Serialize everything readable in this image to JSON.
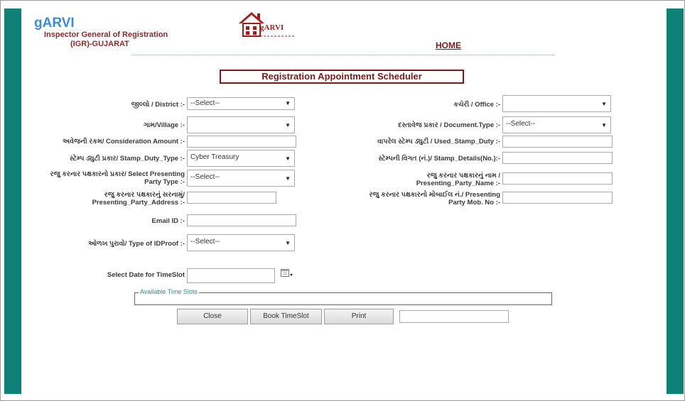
{
  "brand": {
    "name": "gARVI",
    "line1": "Inspector General of Registration",
    "line2": "(IGR)-GUJARAT",
    "logo_text": "gARVI"
  },
  "nav": {
    "home": "HOME"
  },
  "form": {
    "title": "Registration Appointment Scheduler",
    "district": {
      "label": "જીલ્લો / District :-",
      "value": "--Select--"
    },
    "office": {
      "label": "કચેરી / Office :-",
      "value": ""
    },
    "village": {
      "label": "ગામ/Village :-",
      "value": ""
    },
    "document_type": {
      "label": "દસ્તાવેજ પ્રકાર / Document.Type :-",
      "value": "--Select--"
    },
    "consideration_amount": {
      "label": "અવેજની રકમ/ Consideration Amount :-",
      "value": ""
    },
    "used_stamp_duty": {
      "label": "વાપરેલ સ્ટેમ્પ ડ્યુટી / Used_Stamp_Duty :-",
      "value": ""
    },
    "stamp_duty_type": {
      "label": "સ્ટેમ્પ ડ્યુટી પ્રકાર/ Stamp_Duty_Type :-",
      "value": "Cyber Treasury"
    },
    "stamp_details": {
      "label": "સ્ટેમ્પની વિગત (નં.)/ Stamp_Details(No.):-",
      "value": ""
    },
    "presenting_party_type": {
      "label_line1": "રજુ કરનાર પક્ષકારનો પ્રકાર/ Select Presenting",
      "label_line2": "Party Type :-",
      "value": "--Select--"
    },
    "presenting_party_name": {
      "label_line1": "રજુ કરનાર પક્ષકારનું નામ /",
      "label_line2": "Presenting_Party_Name :-",
      "value": ""
    },
    "presenting_party_address": {
      "label_line1": "રજુ કરનાર પક્ષકારનું સરનામું/",
      "label_line2": "Presenting_Party_Address :-",
      "value": ""
    },
    "presenting_party_mobile": {
      "label_line1": "રજુ કરનાર પક્ષકારનો મોબાઈલ નં./ Presenting",
      "label_line2": "Party Mob. No :-",
      "value": ""
    },
    "email": {
      "label": "Email ID :-",
      "value": ""
    },
    "id_proof": {
      "label": "ઓળખ પુરાવો/ Type of IDProof :-",
      "value": "--Select--"
    },
    "date": {
      "label": "Select Date for TimeSlot",
      "value": ""
    },
    "timeslots_legend": "Available Time Slots"
  },
  "buttons": {
    "close": "Close",
    "book": "Book TimeSlot",
    "print": "Print"
  },
  "status_field": {
    "value": ""
  },
  "colors": {
    "side_bar": "#0e8078",
    "brand_blue": "#3d8bd4",
    "maroon": "#7a1a1a"
  }
}
